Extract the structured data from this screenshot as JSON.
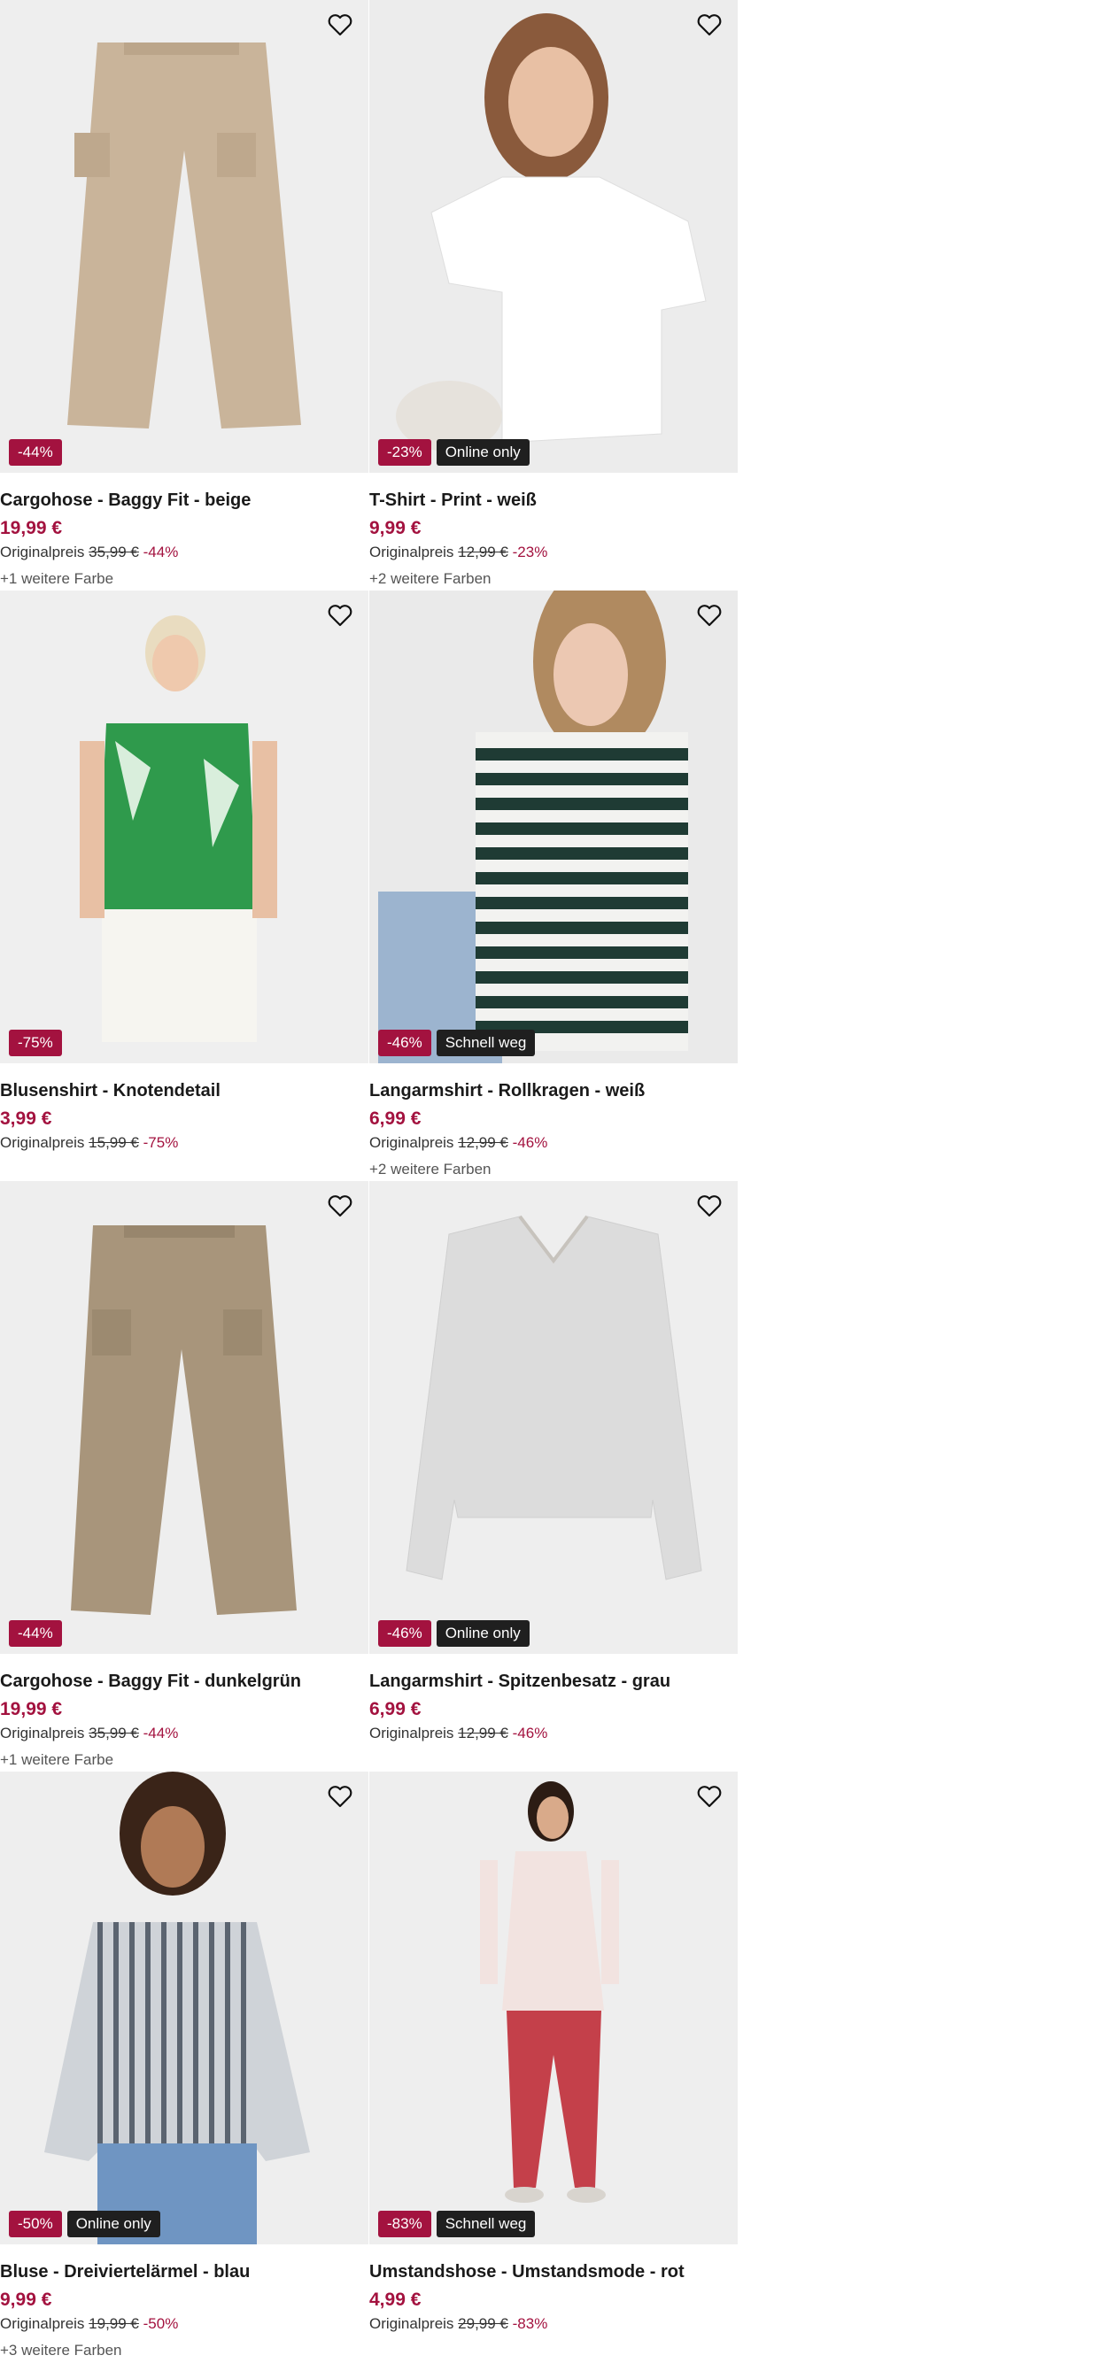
{
  "products": [
    {
      "title": "Cargohose - Baggy Fit - beige",
      "price": "19,99 €",
      "orig_label": "Originalpreis",
      "orig_price": "35,99 €",
      "discount": "-44%",
      "badge": "-44%",
      "tag": "",
      "colors": "+1 weitere Farbe"
    },
    {
      "title": "T-Shirt - Print - weiß",
      "price": "9,99 €",
      "orig_label": "Originalpreis",
      "orig_price": "12,99 €",
      "discount": "-23%",
      "badge": "-23%",
      "tag": "Online only",
      "colors": "+2 weitere Farben"
    },
    {
      "title": "Blusenshirt - Knotendetail",
      "price": "3,99 €",
      "orig_label": "Originalpreis",
      "orig_price": "15,99 €",
      "discount": "-75%",
      "badge": "-75%",
      "tag": "",
      "colors": ""
    },
    {
      "title": "Langarmshirt - Rollkragen - weiß",
      "price": "6,99 €",
      "orig_label": "Originalpreis",
      "orig_price": "12,99 €",
      "discount": "-46%",
      "badge": "-46%",
      "tag": "Schnell weg",
      "colors": "+2 weitere Farben"
    },
    {
      "title": "Cargohose - Baggy Fit - dunkelgrün",
      "price": "19,99 €",
      "orig_label": "Originalpreis",
      "orig_price": "35,99 €",
      "discount": "-44%",
      "badge": "-44%",
      "tag": "",
      "colors": "+1 weitere Farbe"
    },
    {
      "title": "Langarmshirt - Spitzenbesatz - grau",
      "price": "6,99 €",
      "orig_label": "Originalpreis",
      "orig_price": "12,99 €",
      "discount": "-46%",
      "badge": "-46%",
      "tag": "Online only",
      "colors": ""
    },
    {
      "title": "Bluse - Dreiviertelärmel - blau",
      "price": "9,99 €",
      "orig_label": "Originalpreis",
      "orig_price": "19,99 €",
      "discount": "-50%",
      "badge": "-50%",
      "tag": "Online only",
      "colors": "+3 weitere Farben"
    },
    {
      "title": "Umstandshose - Umstandsmode - rot",
      "price": "4,99 €",
      "orig_label": "Originalpreis",
      "orig_price": "29,99 €",
      "discount": "-83%",
      "badge": "-83%",
      "tag": "Schnell weg",
      "colors": ""
    }
  ],
  "icons": {
    "favorite": "heart-outline-icon"
  },
  "colors": {
    "sale": "#a3123f",
    "tag_bg": "#1f1f1f",
    "image_bg": "#f1f1f1"
  }
}
